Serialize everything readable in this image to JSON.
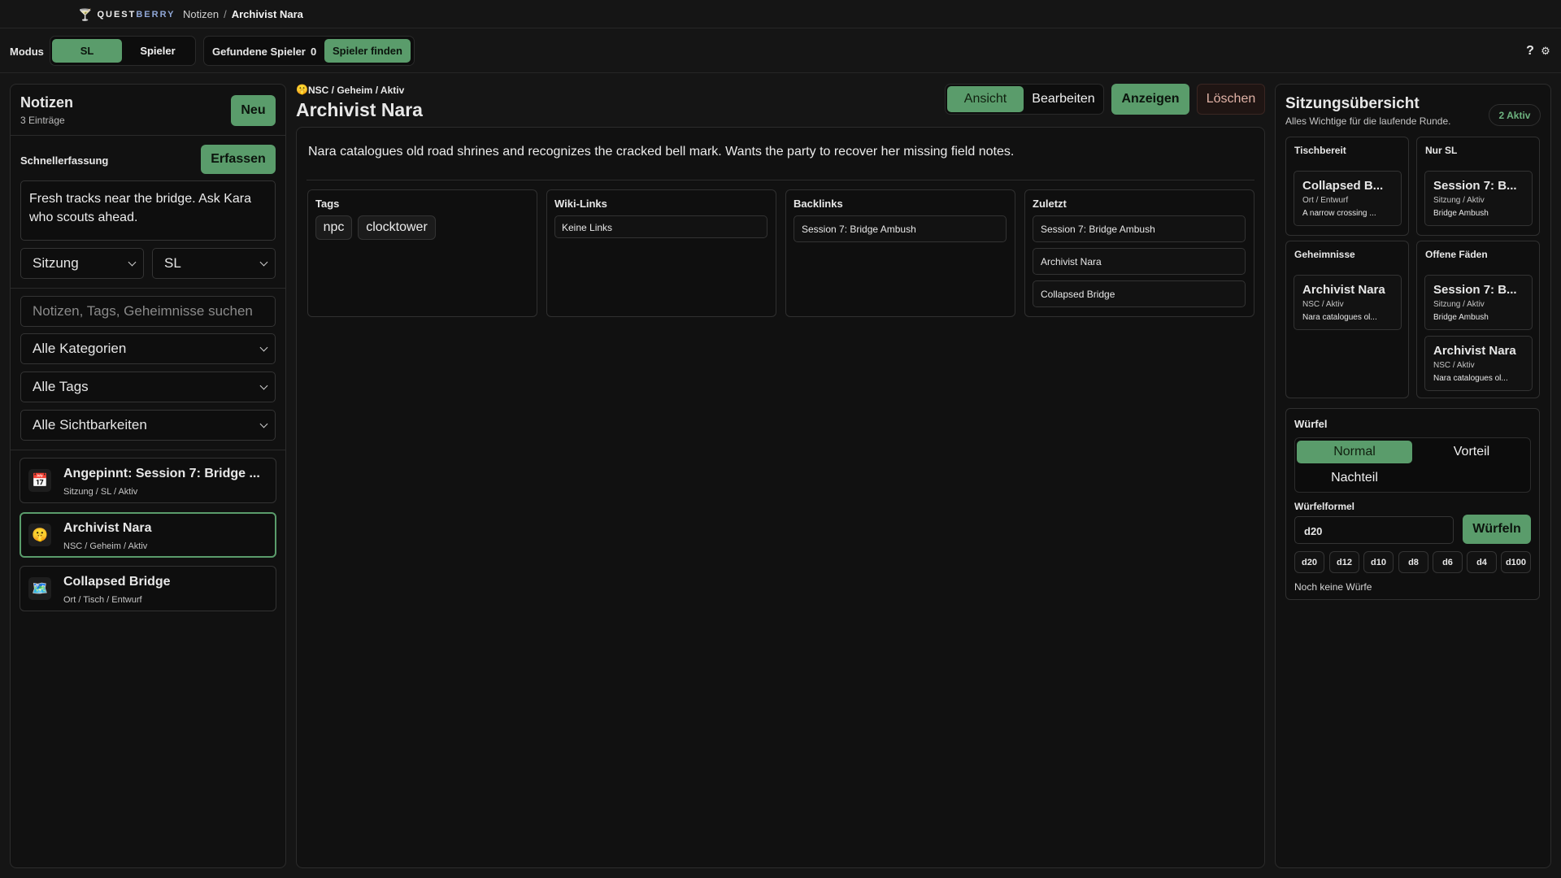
{
  "colors": {
    "accent": "#5a9c6b",
    "background": "#151515",
    "panel": "#111111",
    "danger_text": "#e0b2a6"
  },
  "topbar": {
    "brand_quest": "QUEST",
    "brand_berry": "BERRY",
    "breadcrumb": {
      "parent": "Notizen",
      "separator": "/",
      "current": "Archivist Nara"
    }
  },
  "toolbar": {
    "mode_label": "Modus",
    "mode_options": [
      "SL",
      "Spieler"
    ],
    "found_label": "Gefundene Spieler",
    "found_count": "0",
    "find_button": "Spieler finden",
    "help_label": "?",
    "settings_label": "⚙"
  },
  "sidebar": {
    "title": "Notizen",
    "count": "3 Einträge",
    "new_button": "Neu",
    "quick_label": "Schnellerfassung",
    "quick_button": "Erfassen",
    "quick_text": "Fresh tracks near the bridge. Ask Kara who scouts ahead.",
    "quick_type": "Sitzung",
    "quick_visibility": "SL",
    "search_placeholder": "Notizen, Tags, Geheimnisse suchen",
    "filters": {
      "category": "Alle Kategorien",
      "tags": "Alle Tags",
      "visibility": "Alle Sichtbarkeiten"
    },
    "items": [
      {
        "icon": "calendar-icon",
        "glyph": "📅",
        "title": "Angepinnt: Session 7: Bridge ...",
        "meta": "Sitzung / SL / Aktiv"
      },
      {
        "icon": "face-icon",
        "glyph": "🤫",
        "title": "Archivist Nara",
        "meta": "NSC / Geheim / Aktiv"
      },
      {
        "icon": "map-icon",
        "glyph": "🗺️",
        "title": "Collapsed Bridge",
        "meta": "Ort / Tisch / Entwurf"
      }
    ]
  },
  "note": {
    "glyph": "🤫",
    "meta": "NSC / Geheim / Aktiv",
    "title": "Archivist Nara",
    "view_tabs": [
      "Ansicht",
      "Bearbeiten"
    ],
    "show_button": "Anzeigen",
    "delete_button": "Löschen",
    "body": "Nara catalogues old road shrines and recognizes the cracked bell mark. Wants the party to recover her missing field notes.",
    "tags_title": "Tags",
    "tags": [
      "npc",
      "clocktower"
    ],
    "wiki_title": "Wiki-Links",
    "wiki_empty": "Keine Links",
    "backlinks_title": "Backlinks",
    "backlinks": [
      "Session 7: Bridge Ambush"
    ],
    "recent_title": "Zuletzt",
    "recent": [
      "Session 7: Bridge Ambush",
      "Archivist Nara",
      "Collapsed Bridge"
    ]
  },
  "overview": {
    "title": "Sitzungsübersicht",
    "subtitle": "Alles Wichtige für die laufende Runde.",
    "badge": "2 Aktiv",
    "sections": {
      "table": {
        "title": "Tischbereit",
        "cards": [
          {
            "title": "Collapsed B...",
            "meta": "Ort / Entwurf",
            "desc": "A narrow crossing ..."
          }
        ]
      },
      "gm": {
        "title": "Nur SL",
        "cards": [
          {
            "title": "Session 7: B...",
            "meta": "Sitzung / Aktiv",
            "desc": "Bridge Ambush"
          }
        ]
      },
      "secrets": {
        "title": "Geheimnisse",
        "cards": [
          {
            "title": "Archivist Nara",
            "meta": "NSC / Aktiv",
            "desc": "Nara catalogues ol..."
          }
        ]
      },
      "threads": {
        "title": "Offene Fäden",
        "cards": [
          {
            "title": "Session 7: B...",
            "meta": "Sitzung / Aktiv",
            "desc": "Bridge Ambush"
          },
          {
            "title": "Archivist Nara",
            "meta": "NSC / Aktiv",
            "desc": "Nara catalogues ol..."
          }
        ]
      }
    }
  },
  "dice": {
    "title": "Würfel",
    "modes": [
      "Normal",
      "Vorteil",
      "Nachteil"
    ],
    "formula_label": "Würfelformel",
    "formula_value": "d20",
    "roll_button": "Würfeln",
    "presets": [
      "d20",
      "d12",
      "d10",
      "d8",
      "d6",
      "d4",
      "d100"
    ],
    "empty": "Noch keine Würfe"
  }
}
